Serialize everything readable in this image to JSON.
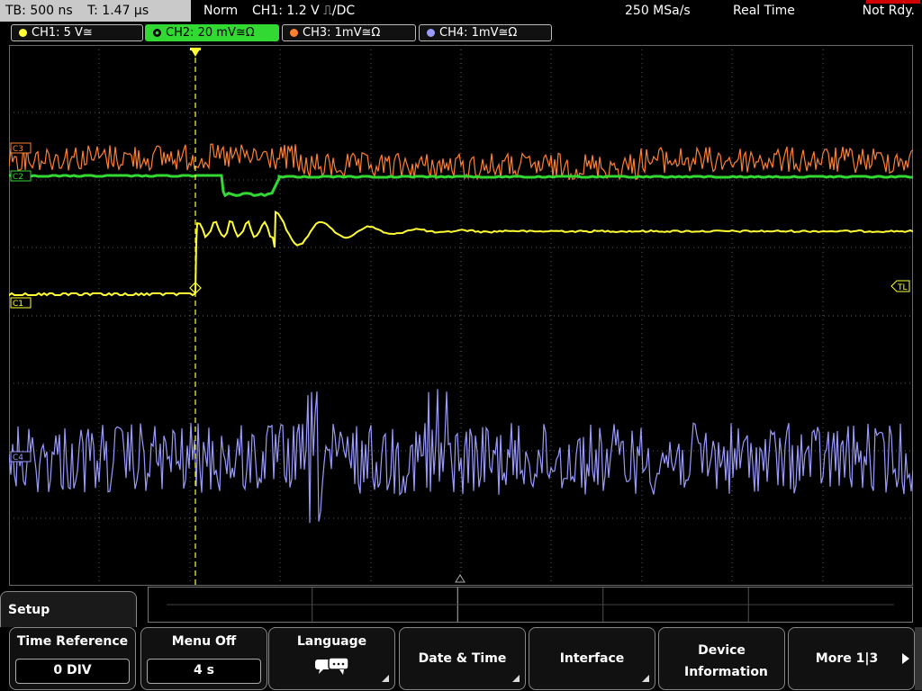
{
  "status": {
    "timebase": "TB: 500 ns",
    "trigger_time": "T: 1.47 µs",
    "mode": "Norm",
    "trigger": "CH1: 1.2 V ⎍/DC",
    "sample_rate": "250 MSa/s",
    "acq_mode": "Real Time",
    "ready": "Not Rdy."
  },
  "channels": [
    {
      "label": "CH1: 5 V≅",
      "color": "#ffff33",
      "marker": "C1"
    },
    {
      "label": "CH2: 20 mV≅Ω",
      "color": "#33d933",
      "marker": "C2"
    },
    {
      "label": "CH3: 1mV≅Ω",
      "color": "#ff8030",
      "marker": "C3"
    },
    {
      "label": "CH4: 1mV≅Ω",
      "color": "#9a9aff",
      "marker": "C4"
    }
  ],
  "trigger_level_marker": "TL",
  "menu": {
    "title": "Setup",
    "softkeys": [
      {
        "label": "Time Reference",
        "value": "0 DIV"
      },
      {
        "label": "Menu Off",
        "value": "4 s"
      },
      {
        "label": "Language",
        "icon": "speech-bubbles-icon"
      },
      {
        "label": "Date & Time"
      },
      {
        "label": "Interface"
      },
      {
        "label": "Device Information"
      },
      {
        "label": "More 1|3"
      }
    ]
  },
  "colors": {
    "grid": "#5a5a5a",
    "trigger_line": "#ffff33",
    "ch2_active": "#33d933"
  }
}
